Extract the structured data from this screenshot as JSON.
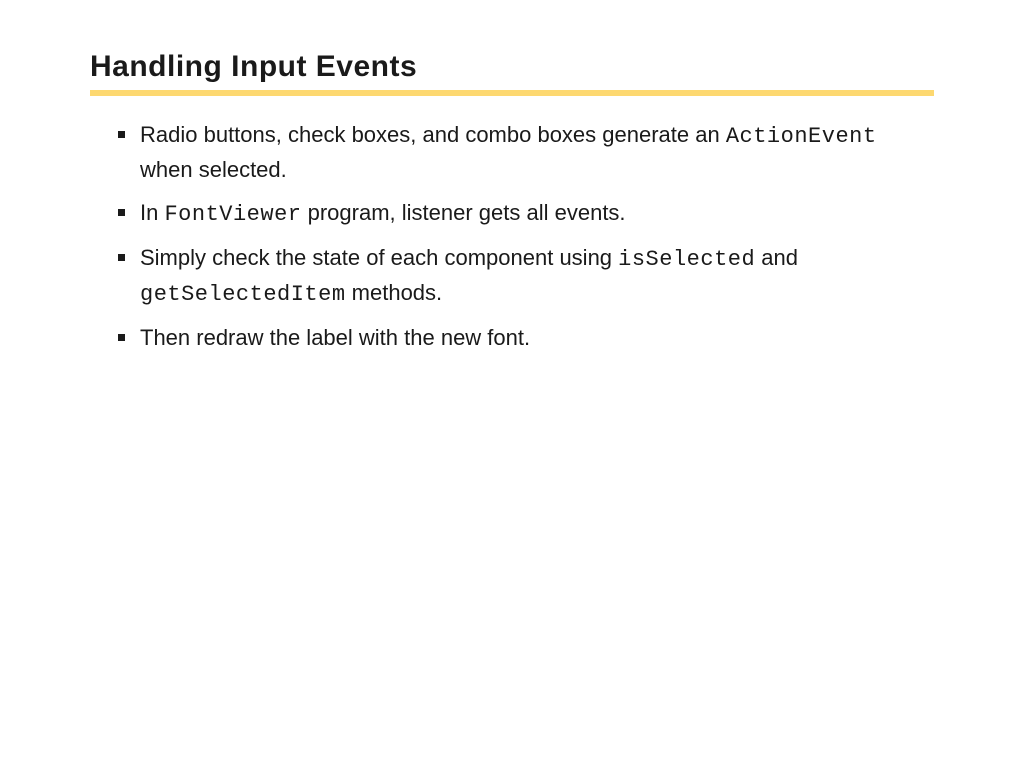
{
  "title": "Handling Input Events",
  "bullets": {
    "b0": {
      "t0": "Radio buttons, check boxes, and combo boxes generate an ",
      "c0": "ActionEvent",
      "t1": " when selected."
    },
    "b1": {
      "t0": "In ",
      "c0": "FontViewer",
      "t1": " program, listener gets all events."
    },
    "b2": {
      "t0": "Simply check the state of each component using ",
      "c0": "isSelected",
      "t1": " and ",
      "c1": "getSelectedItem",
      "t2": " methods."
    },
    "b3": {
      "t0": "Then redraw the label with the new font."
    }
  }
}
